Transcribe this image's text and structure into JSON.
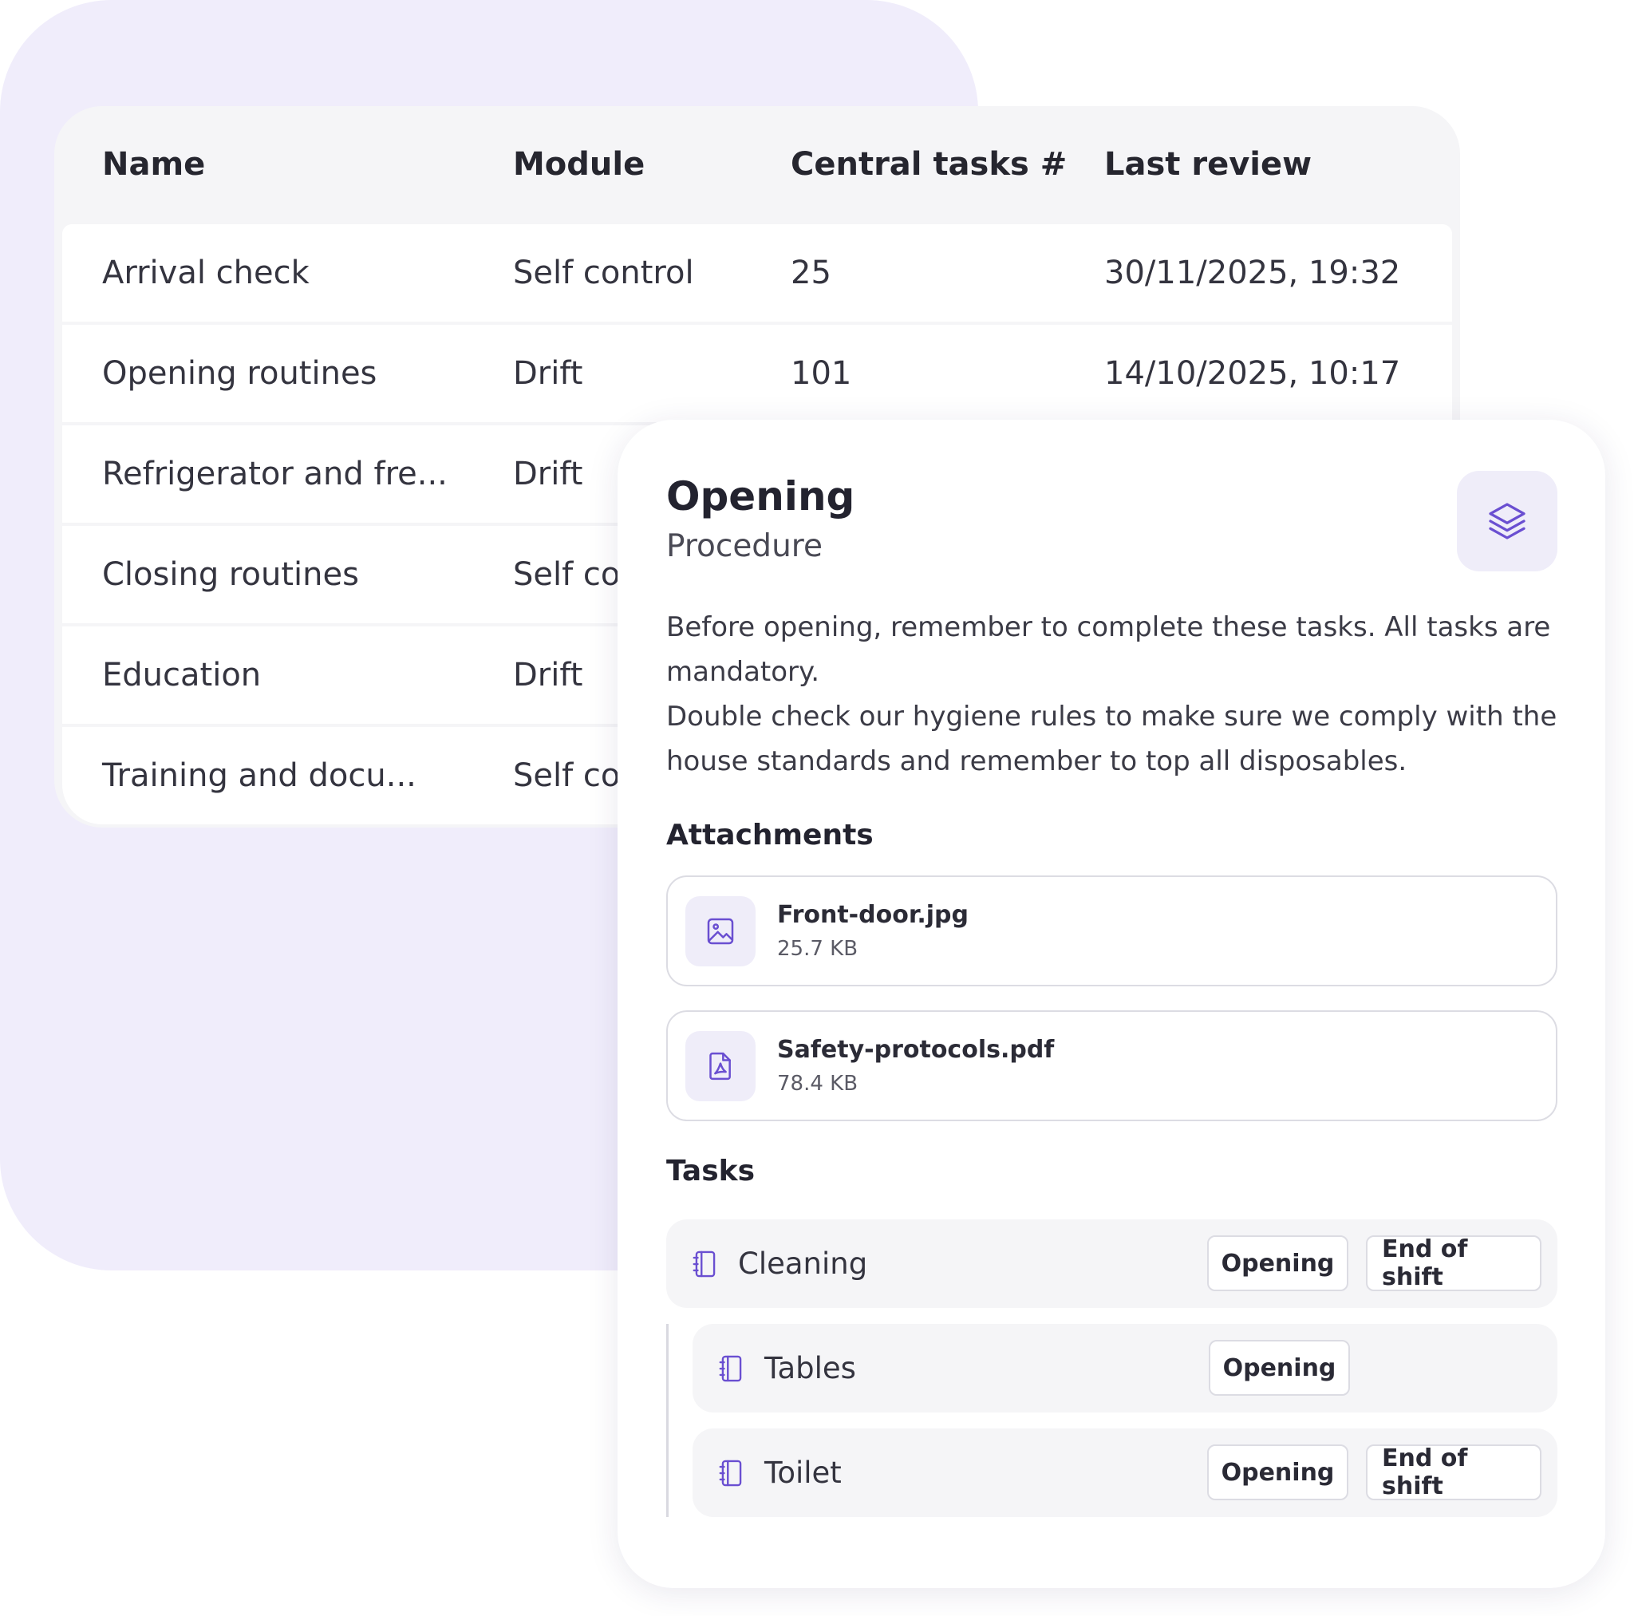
{
  "table": {
    "columns": [
      "Name",
      "Module",
      "Central tasks #",
      "Last review"
    ],
    "rows": [
      {
        "name": "Arrival check",
        "module": "Self control",
        "tasks": "25",
        "review": "30/11/2025, 19:32"
      },
      {
        "name": "Opening routines",
        "module": "Drift",
        "tasks": "101",
        "review": "14/10/2025, 10:17"
      },
      {
        "name": "Refrigerator and fre...",
        "module": "Drift",
        "tasks": "",
        "review": ""
      },
      {
        "name": "Closing routines",
        "module": "Self con",
        "tasks": "",
        "review": ""
      },
      {
        "name": "Education",
        "module": "Drift",
        "tasks": "",
        "review": ""
      },
      {
        "name": "Training and docu...",
        "module": "Self con",
        "tasks": "",
        "review": ""
      }
    ]
  },
  "panel": {
    "title": "Opening",
    "subtitle": "Procedure",
    "description_1": "Before opening, remember to complete these tasks. All tasks are mandatory.",
    "description_2": "Double check our hygiene rules to make sure we comply with the house standards and remember to top all disposables.",
    "attachments_heading": "Attachments",
    "attachments": [
      {
        "name": "Front-door.jpg",
        "size": "25.7 KB",
        "icon": "image-icon"
      },
      {
        "name": "Safety-protocols.pdf",
        "size": "78.4 KB",
        "icon": "pdf-file-icon"
      }
    ],
    "tasks_heading": "Tasks",
    "tasks": [
      {
        "label": "Cleaning",
        "tags": [
          "Opening",
          "End of shift"
        ]
      },
      {
        "label": "Tables",
        "tags": [
          "Opening"
        ]
      },
      {
        "label": "Toilet",
        "tags": [
          "Opening",
          "End of shift"
        ]
      }
    ]
  },
  "colors": {
    "backdrop": "#f0edfb",
    "accent": "#6a4fd1",
    "icon_bg": "#efedf9"
  }
}
